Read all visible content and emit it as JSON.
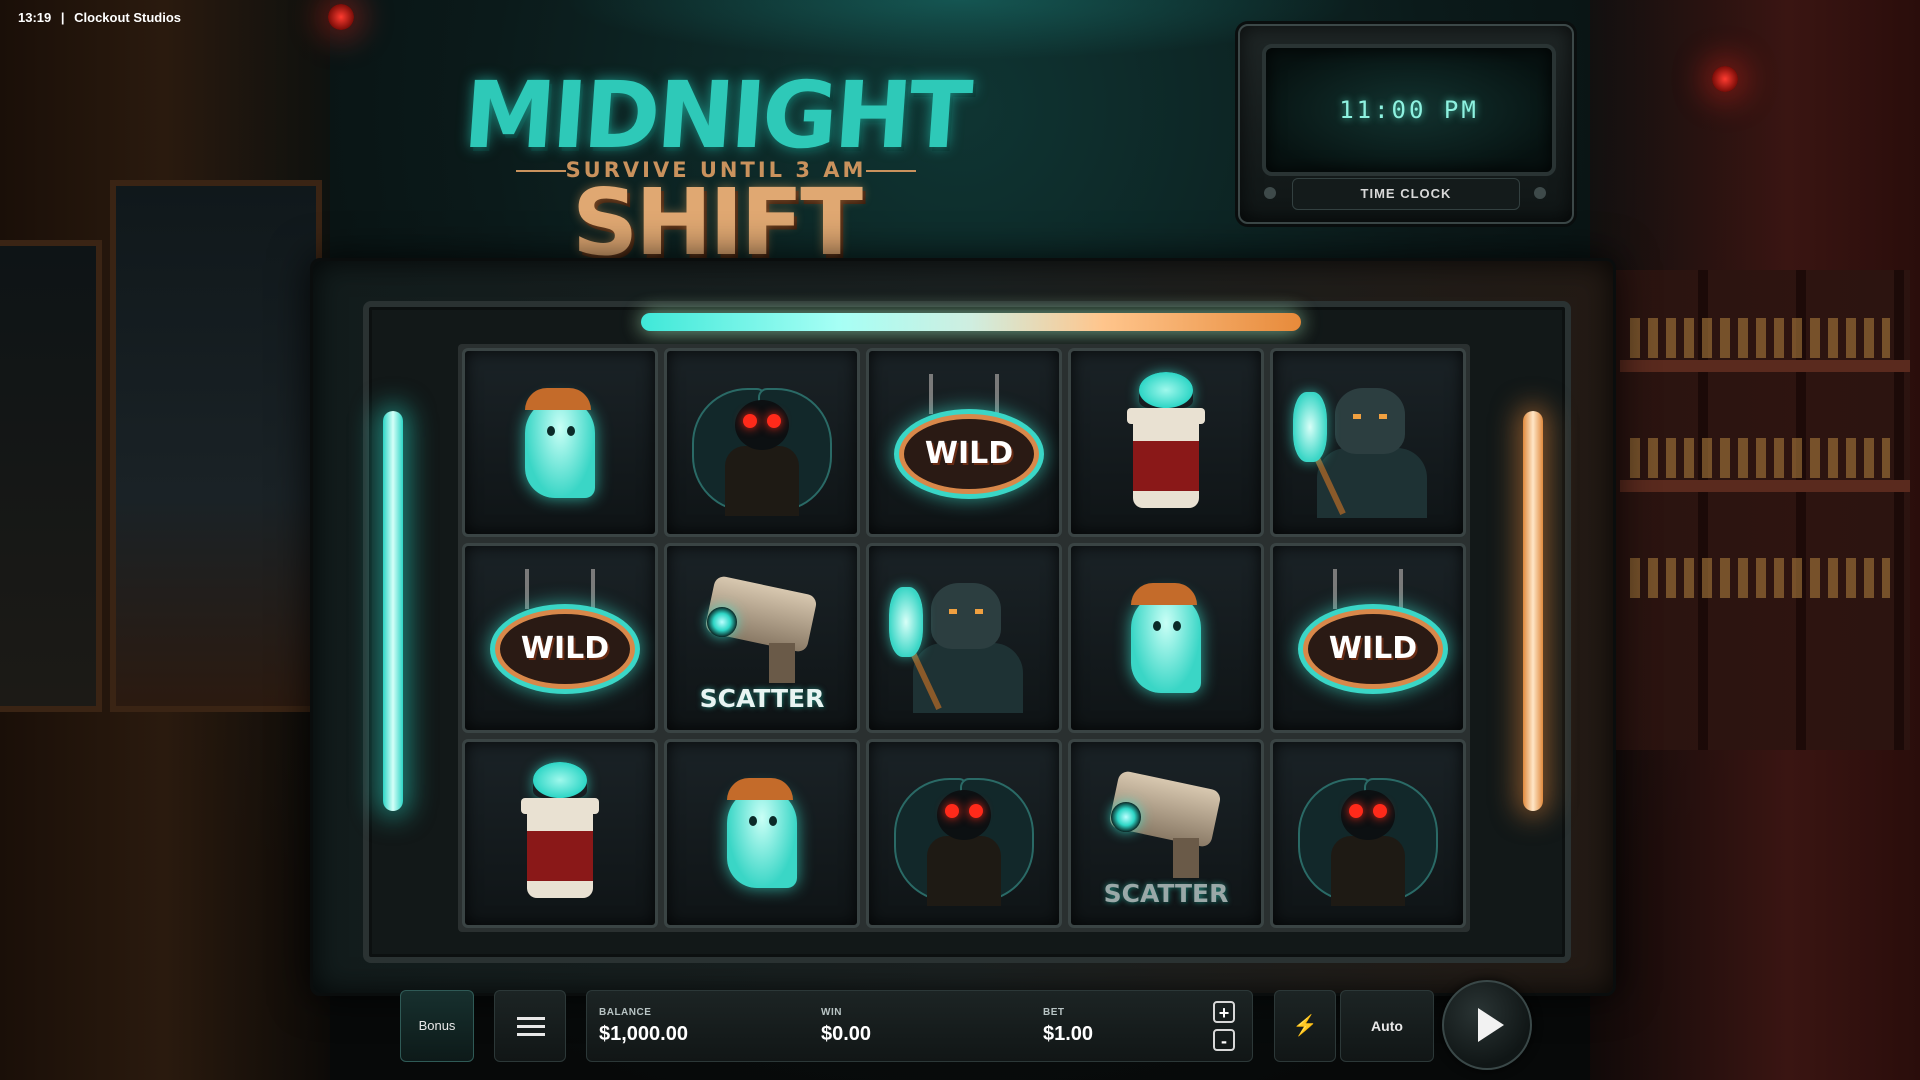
{
  "status_bar": {
    "time": "13:19",
    "separator": "|",
    "studio": "Clockout Studios"
  },
  "title": {
    "part1": "MIDNIGHT",
    "part2": "SHIFT",
    "tagline": "SURVIVE UNTIL 3 AM"
  },
  "time_clock": {
    "display": "11:00 PM",
    "label": "TIME CLOCK"
  },
  "reels": [
    [
      "ghost-clerk",
      "mothman",
      "wild",
      "bat-coffee",
      "werewolf-janitor"
    ],
    [
      "wild",
      "scatter-camera",
      "werewolf-janitor",
      "ghost-clerk",
      "wild"
    ],
    [
      "bat-coffee",
      "ghost-clerk",
      "mothman",
      "scatter-camera",
      "mothman"
    ]
  ],
  "symbol_labels": {
    "wild": "WILD",
    "scatter": "SCATTER"
  },
  "controls": {
    "bonus_label": "Bonus",
    "menu_icon": "hamburger-icon",
    "balance_label": "BALANCE",
    "balance_value": "$1,000.00",
    "win_label": "WIN",
    "win_value": "$0.00",
    "bet_label": "BET",
    "bet_value": "$1.00",
    "bet_increase": "+",
    "bet_decrease": "-",
    "turbo_icon": "lightning-icon",
    "auto_label": "Auto",
    "spin_icon": "play-icon"
  },
  "colors": {
    "teal": "#2ec9b8",
    "amber": "#e0a872",
    "red_eyes": "#ff2a1a"
  }
}
